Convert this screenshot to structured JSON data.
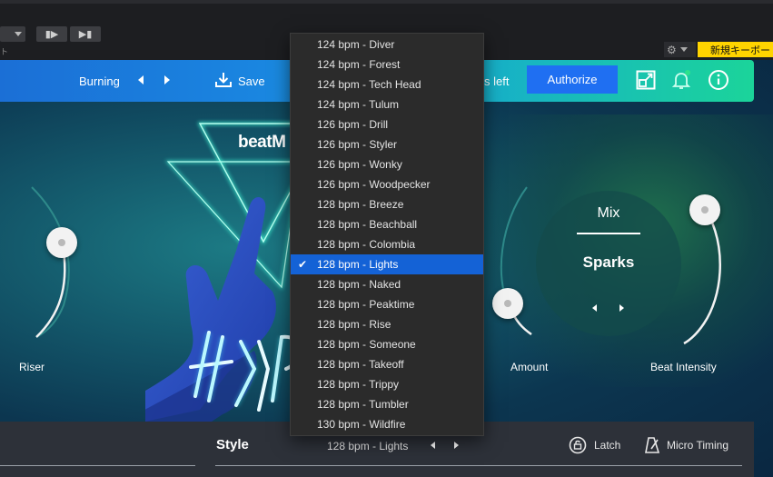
{
  "host": {
    "sub_text": "ト",
    "keyboard_label": "新規キーボード",
    "btn_prev_glyph": "▮▶",
    "btn_next_glyph": "▶▮",
    "gear_glyph": "⚙"
  },
  "header": {
    "preset": "Burning",
    "save_label": "Save",
    "trial_fragment": "s left",
    "authorize_label": "Authorize"
  },
  "art": {
    "logo_text": "beatM"
  },
  "knobs": {
    "riser_label": "Riser",
    "amount_label": "Amount",
    "beat_intensity_label": "Beat Intensity"
  },
  "mix": {
    "title": "Mix",
    "value": "Sparks"
  },
  "bottom": {
    "style_title": "Style",
    "style_value": "128 bpm - Lights",
    "latch_label": "Latch",
    "micro_timing_label": "Micro Timing"
  },
  "menu": {
    "items": [
      "124 bpm - Diver",
      "124 bpm - Forest",
      "124 bpm - Tech Head",
      "124 bpm - Tulum",
      "126 bpm - Drill",
      "126 bpm - Styler",
      "126 bpm - Wonky",
      "126 bpm - Woodpecker",
      "128 bpm - Breeze",
      "128 bpm - Beachball",
      "128 bpm - Colombia",
      "128 bpm - Lights",
      "128 bpm - Naked",
      "128 bpm - Peaktime",
      "128 bpm - Rise",
      "128 bpm - Someone",
      "128 bpm - Takeoff",
      "128 bpm - Trippy",
      "128 bpm - Tumbler",
      "130 bpm - Wildfire"
    ],
    "selected": "128 bpm - Lights",
    "check_glyph": "✔"
  },
  "colors": {
    "accent": "#1f6ff2",
    "selection": "#1462d6",
    "header_start": "#1b6fd6",
    "header_end": "#1bd49a",
    "keyboard_badge": "#ffd400"
  }
}
